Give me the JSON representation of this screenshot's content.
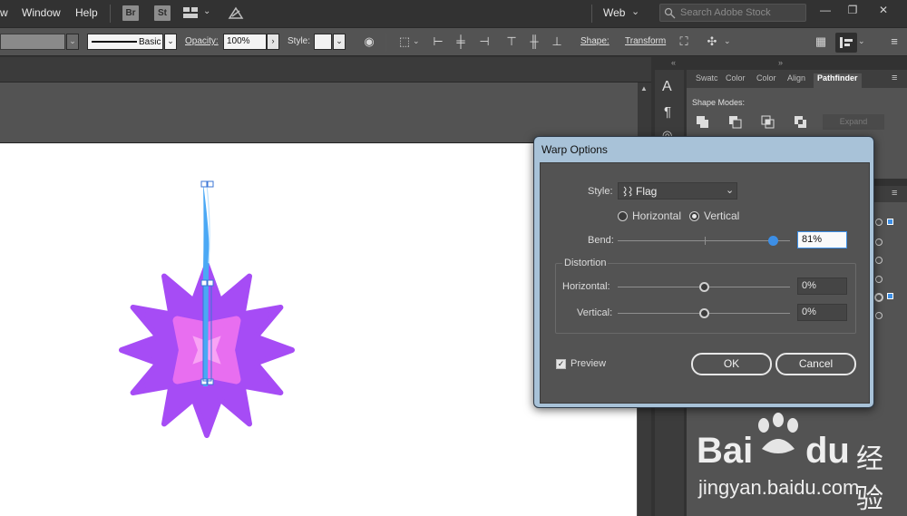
{
  "menubar": {
    "items": [
      "w",
      "Window",
      "Help"
    ],
    "apps": [
      "Br",
      "St"
    ],
    "workspace": "Web",
    "search_placeholder": "Search Adobe Stock"
  },
  "control_bar": {
    "stroke_style": "Basic",
    "opacity_label": "Opacity:",
    "opacity_value": "100%",
    "style_label": "Style:",
    "shape_label": "Shape:",
    "transform_label": "Transform"
  },
  "panels": {
    "tabs": [
      "Swatc",
      "Color",
      "Color",
      "Align",
      "Pathfinder"
    ],
    "active_tab": "Pathfinder",
    "shape_modes_label": "Shape Modes:",
    "expand_label": "Expand"
  },
  "warp_dialog": {
    "title": "Warp Options",
    "style_label": "Style:",
    "style_value": "Flag",
    "orientation": {
      "horizontal_label": "Horizontal",
      "vertical_label": "Vertical",
      "selected": "Vertical"
    },
    "bend_label": "Bend:",
    "bend_value": "81%",
    "bend_fraction": 0.81,
    "distortion_group_label": "Distortion",
    "dist_h_label": "Horizontal:",
    "dist_h_value": "0%",
    "dist_v_label": "Vertical:",
    "dist_v_value": "0%",
    "preview_label": "Preview",
    "preview_checked": true,
    "ok_label": "OK",
    "cancel_label": "Cancel"
  },
  "watermark": {
    "brand": "Bai",
    "brand2": "du",
    "cn": "经验",
    "url": "jingyan.baidu.com"
  },
  "colors": {
    "star_outer": "#a64cf5",
    "star_inner": "#e86ef0",
    "star_center": "#f9a3f5",
    "flag_blue": "#4aa8f5",
    "accent_blue": "#3d8fe6"
  }
}
